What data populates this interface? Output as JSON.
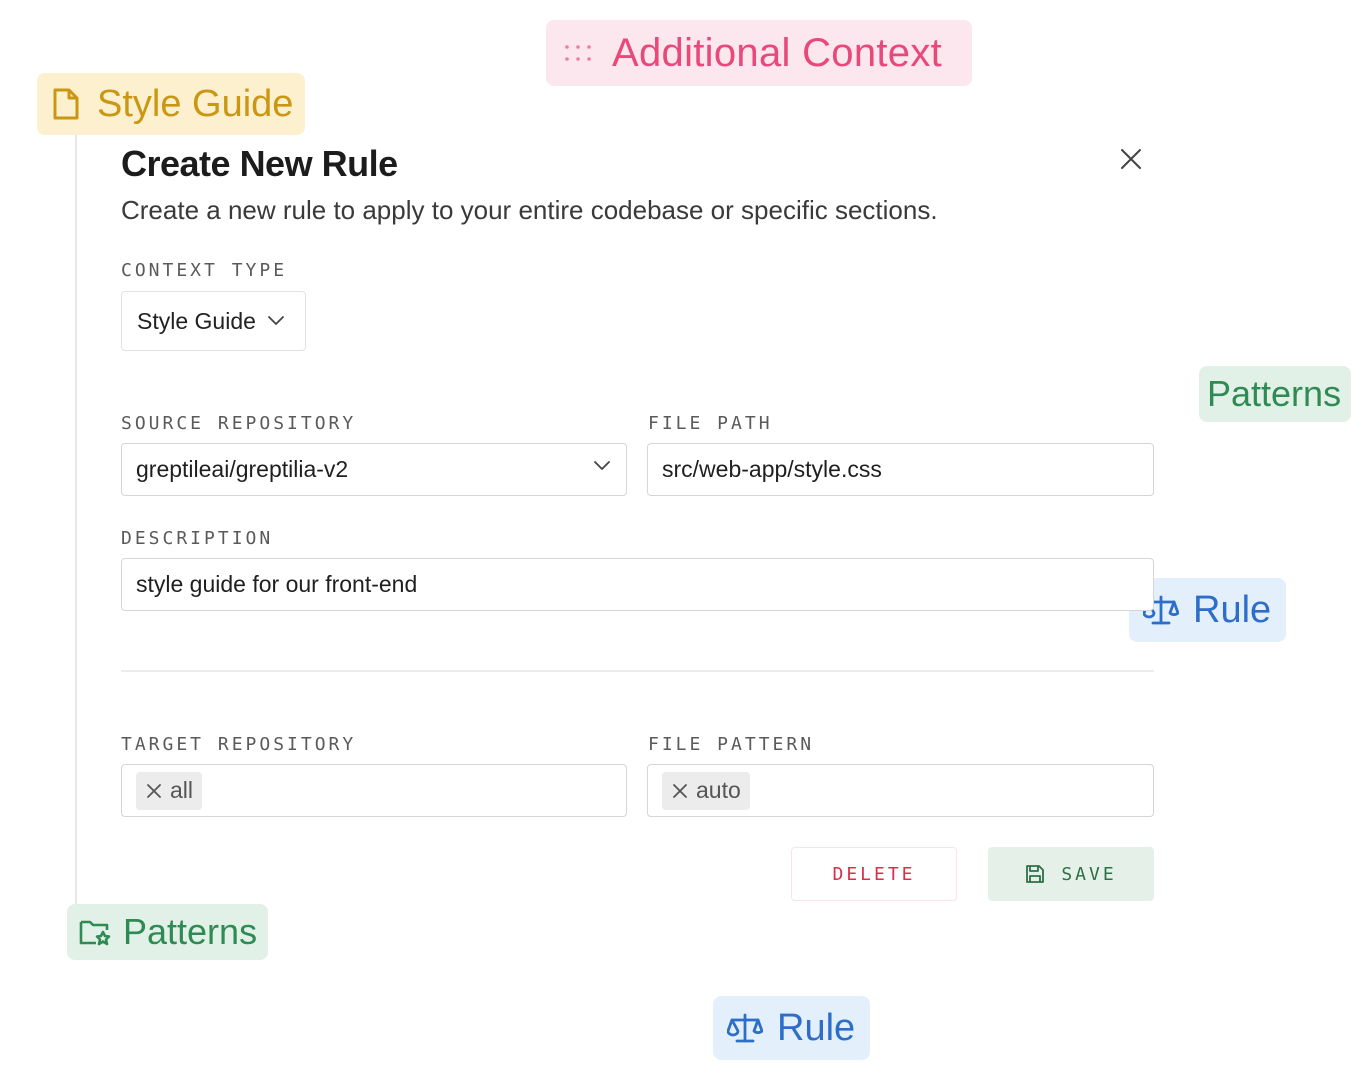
{
  "chips": {
    "additional_context": "Additional Context",
    "style_guide": "Style Guide",
    "patterns_right": "Patterns",
    "rule_right": "Rule",
    "patterns_left": "Patterns",
    "rule_bottom": "Rule"
  },
  "dialog": {
    "title": "Create New Rule",
    "subtitle": "Create a new rule to apply to your entire codebase or specific sections."
  },
  "form": {
    "context_type": {
      "label": "CONTEXT TYPE",
      "value": "Style Guide"
    },
    "source_repository": {
      "label": "SOURCE REPOSITORY",
      "value": "greptileai/greptilia-v2"
    },
    "file_path": {
      "label": "FILE PATH",
      "value": "src/web-app/style.css"
    },
    "description": {
      "label": "DESCRIPTION",
      "value": "style guide for our front-end"
    },
    "target_repository": {
      "label": "TARGET REPOSITORY",
      "tags": [
        "all"
      ]
    },
    "file_pattern": {
      "label": "FILE PATTERN",
      "tags": [
        "auto"
      ]
    }
  },
  "actions": {
    "delete": "DELETE",
    "save": "SAVE"
  },
  "colors": {
    "context_chip": "#e8487a",
    "style_chip": "#c99711",
    "patterns_chip": "#2f8a53",
    "rule_chip": "#2d6ec9",
    "delete_text": "#d6304a",
    "save_bg": "#e5f1e8"
  },
  "icons": {
    "context": "drag-dots-icon",
    "style": "document-icon",
    "rule": "scale-icon",
    "patterns": "folder-star-icon",
    "close": "close-icon",
    "save": "floppy-disk-icon"
  }
}
